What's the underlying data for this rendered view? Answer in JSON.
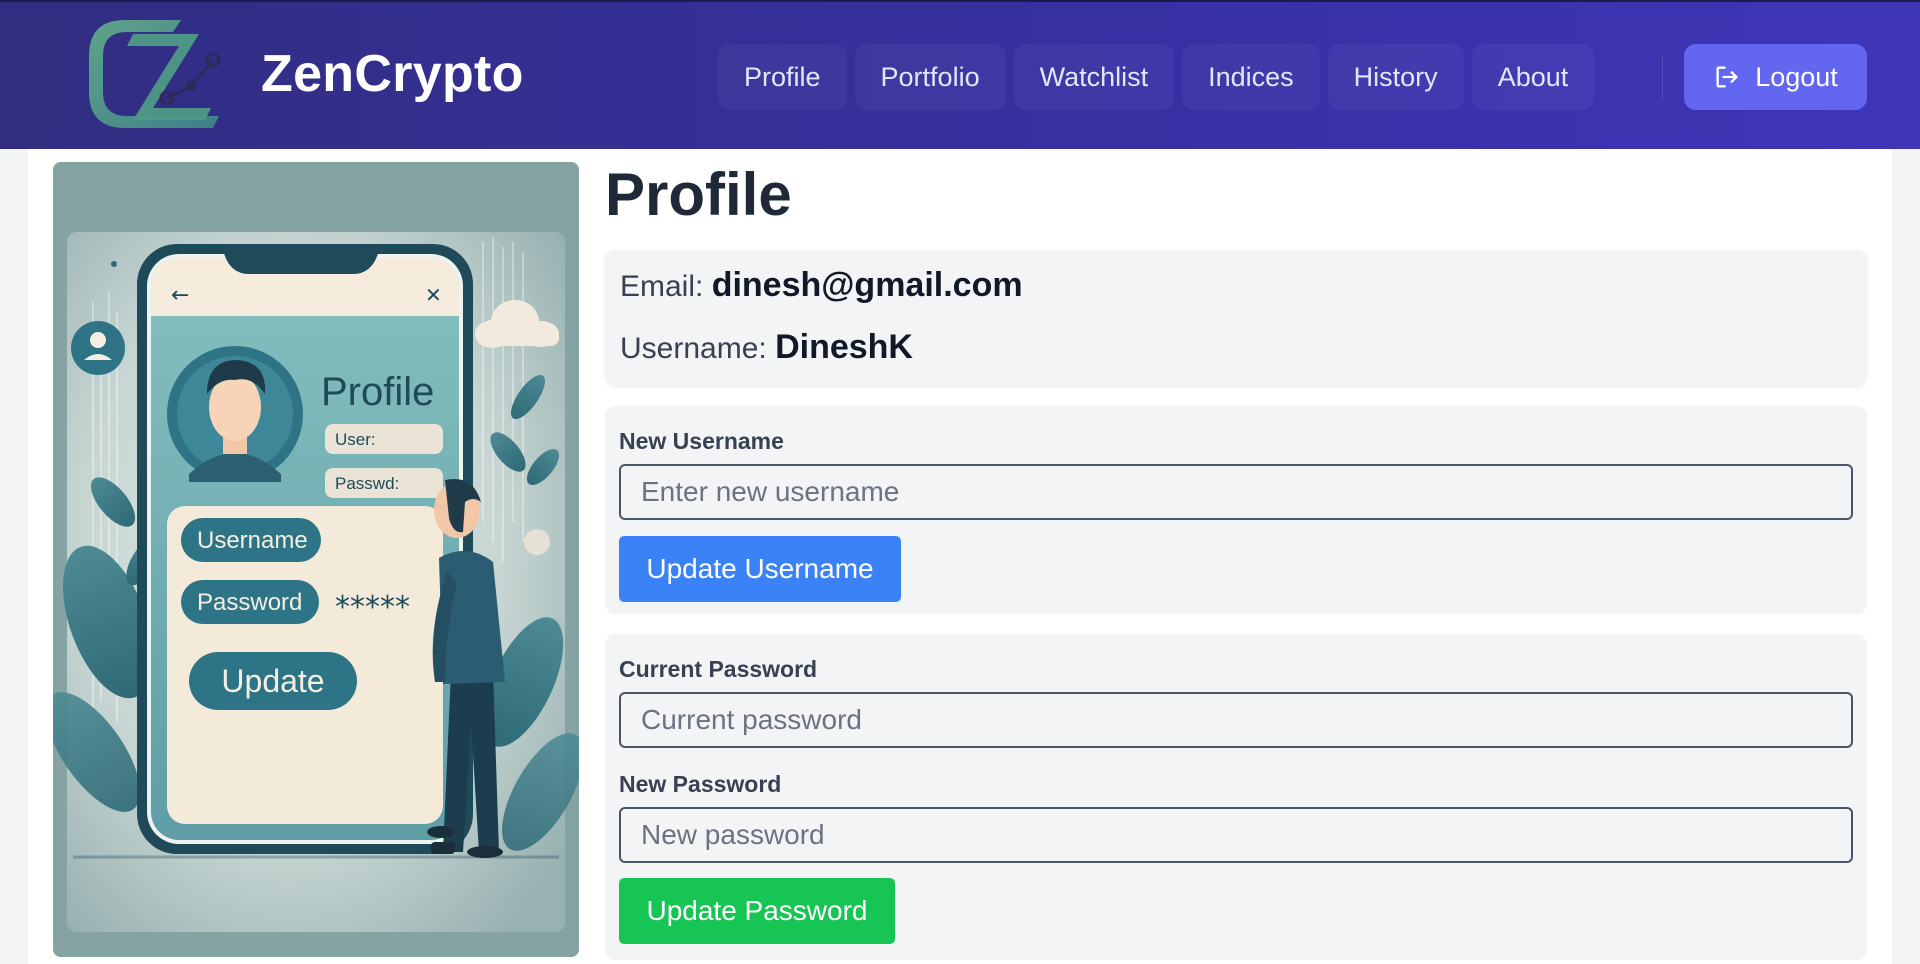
{
  "app": {
    "name": "ZenCrypto"
  },
  "nav": {
    "items": [
      {
        "label": "Profile"
      },
      {
        "label": "Portfolio"
      },
      {
        "label": "Watchlist"
      },
      {
        "label": "Indices"
      },
      {
        "label": "History"
      },
      {
        "label": "About"
      }
    ],
    "logout_label": "Logout",
    "logout_icon": "logout-icon"
  },
  "colors": {
    "navbar": "#3730a3",
    "logout_button": "#6366f1",
    "update_username_button": "#3b82f6",
    "update_password_button": "#16c554"
  },
  "illustration": {
    "title": "Profile",
    "user_field": "User:",
    "pass_field": "Passwd:",
    "username_pill": "Username",
    "password_pill": "Password",
    "masked": "*****",
    "update_button": "Update"
  },
  "profile": {
    "title": "Profile",
    "email_label": "Email:",
    "email": "dinesh@gmail.com",
    "username_label": "Username:",
    "username": "DineshK"
  },
  "username_form": {
    "label": "New Username",
    "placeholder": "Enter new username",
    "button": "Update Username"
  },
  "password_form": {
    "current_label": "Current Password",
    "current_placeholder": "Current password",
    "new_label": "New Password",
    "new_placeholder": "New password",
    "button": "Update Password"
  }
}
